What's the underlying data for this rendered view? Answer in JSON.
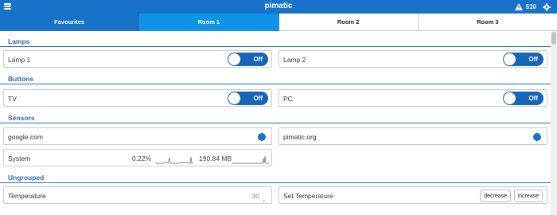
{
  "header": {
    "title": "pimatic",
    "menu_icon": "hamburger-menu-icon",
    "warning_icon": "warning-icon",
    "notification_count": "510",
    "settings_icon": "gear-icon",
    "color": "#1872c9"
  },
  "tabs": [
    {
      "label": "Favourites"
    },
    {
      "label": "Room 1",
      "active": true
    },
    {
      "label": "Room 2"
    },
    {
      "label": "Room 3"
    }
  ],
  "sections": {
    "lamps": "Lamps",
    "buttons": "Buttons",
    "sensors": "Sensors",
    "ungrouped": "Ungrouped"
  },
  "devices": {
    "lamp1": {
      "name": "Lamp 1",
      "state": "Off"
    },
    "lamp2": {
      "name": "Lamp 2",
      "state": "Off"
    },
    "tv": {
      "name": "TV",
      "state": "Off"
    },
    "pc": {
      "name": "PC",
      "state": "Off"
    },
    "google": {
      "name": "google.com",
      "presence_icon": "presence-dot-icon"
    },
    "pimatic_org": {
      "name": "pimatic.org",
      "presence_icon": "presence-dot-icon"
    },
    "system": {
      "name": "System",
      "cpu": "0.22",
      "cpu_unit": "%",
      "memory": "190.84",
      "memory_unit": "MB"
    },
    "temperature": {
      "name": "Temperature",
      "value": "30",
      "caret": "⌄"
    },
    "set_temperature": {
      "name": "Set Temperature",
      "decrease_label": "decrease",
      "increase_label": "increase"
    }
  },
  "colors": {
    "accent": "#1872c9",
    "active_tab": "#0f93e6",
    "toggle": "#1565b8"
  }
}
